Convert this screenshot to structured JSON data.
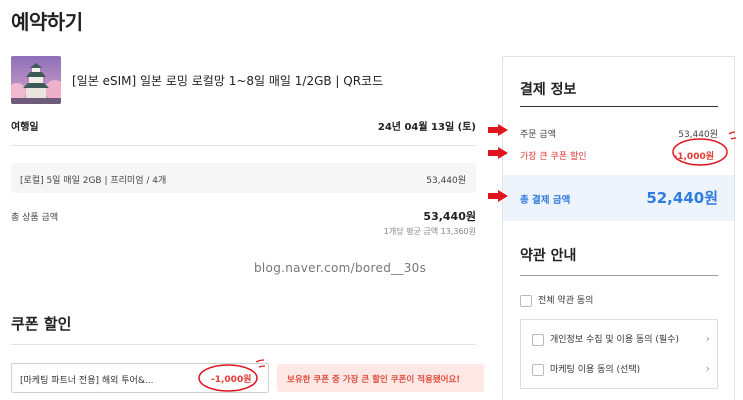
{
  "page": {
    "title": "예약하기"
  },
  "product": {
    "title": "[일본 eSIM] 일본 로밍 로컬망 1~8일 매일 1/2GB | QR코드",
    "thumbnail_icon": "japan-castle-image"
  },
  "trip": {
    "label": "여행일",
    "value": "24년 04월 13일 (토)"
  },
  "option": {
    "name": "[로컬] 5일 매일 2GB | 프리미엄 / 4개",
    "price": "53,440원"
  },
  "total": {
    "label": "총 상품 금액",
    "value": "53,440원",
    "avg": "1개당 평균 금액 13,360원"
  },
  "watermark": "blog.naver.com/bored__30s",
  "coupon": {
    "title": "쿠폰 할인",
    "selected": "[마케팅 파트너 전용] 해외 투어&...",
    "amount": "-1,000원",
    "note": "보유한 쿠폰 중 가장 큰 할인 쿠폰이 적용됐어요!"
  },
  "payment": {
    "title": "결제 정보",
    "order_label": "주문 금액",
    "order_value": "53,440원",
    "coupon_label": "가장 큰 쿠폰 할인",
    "coupon_value": "-1,000원",
    "grand_label": "총 결제 금액",
    "grand_value": "52,440원"
  },
  "terms": {
    "title": "약관 안내",
    "all": "전체 약관 동의",
    "items": [
      "개인정보 수집 및 이용 동의 (필수)",
      "마케팅 이용 동의 (선택)"
    ]
  },
  "colors": {
    "accent_blue": "#2f7de1",
    "discount_red": "#e53935",
    "annotation_red": "#e0141e"
  }
}
